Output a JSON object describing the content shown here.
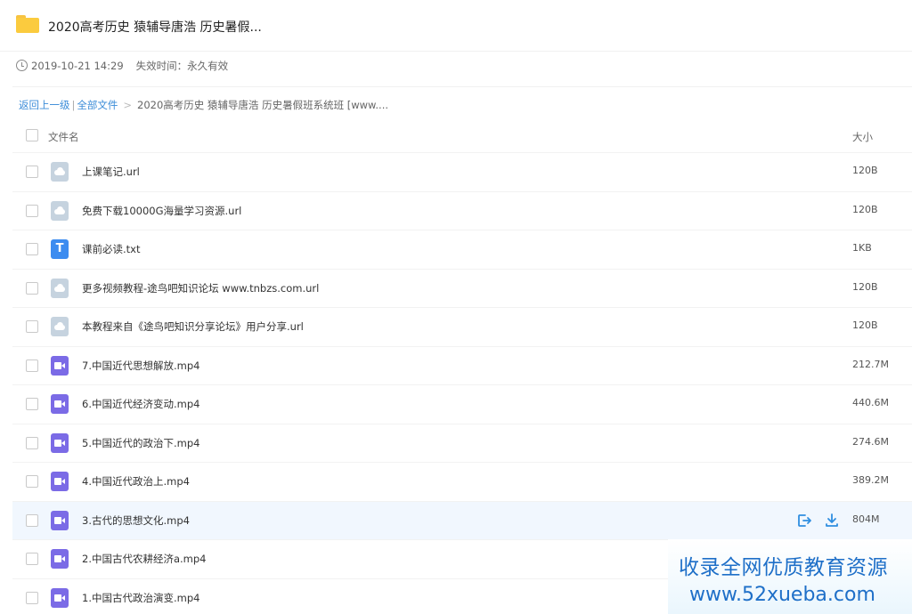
{
  "share": {
    "title": "2020高考历史 猿辅导唐浩 历史暑假...",
    "created_at": "2019-10-21 14:29",
    "expiry_label": "失效时间：",
    "expiry_value": "永久有效"
  },
  "breadcrumb": {
    "back": "返回上一级",
    "separator": "|",
    "all_files": "全部文件",
    "arrow": ">",
    "current": "2020高考历史 猿辅导唐浩 历史暑假班系统班 [www...."
  },
  "columns": {
    "name": "文件名",
    "size": "大小"
  },
  "files": [
    {
      "name": "上课笔记.url",
      "size": "120B",
      "type": "url"
    },
    {
      "name": "免费下载10000G海量学习资源.url",
      "size": "120B",
      "type": "url"
    },
    {
      "name": "课前必读.txt",
      "size": "1KB",
      "type": "txt",
      "icon_letter": "T"
    },
    {
      "name": "更多视频教程-途鸟吧知识论坛 www.tnbzs.com.url",
      "size": "120B",
      "type": "url"
    },
    {
      "name": "本教程来自《途鸟吧知识分享论坛》用户分享.url",
      "size": "120B",
      "type": "url"
    },
    {
      "name": "7.中国近代思想解放.mp4",
      "size": "212.7M",
      "type": "mp4"
    },
    {
      "name": "6.中国近代经济变动.mp4",
      "size": "440.6M",
      "type": "mp4"
    },
    {
      "name": "5.中国近代的政治下.mp4",
      "size": "274.6M",
      "type": "mp4"
    },
    {
      "name": "4.中国近代政治上.mp4",
      "size": "389.2M",
      "type": "mp4"
    },
    {
      "name": "3.古代的思想文化.mp4",
      "size": "804M",
      "type": "mp4"
    },
    {
      "name": "2.中国古代农耕经济a.mp4",
      "size": "",
      "type": "mp4"
    },
    {
      "name": "1.中国古代政治演变.mp4",
      "size": "",
      "type": "mp4"
    }
  ],
  "watermark": {
    "line1": "收录全网优质教育资源",
    "line2": "www.52xueba.com"
  },
  "colors": {
    "link": "#3b8cd8",
    "folder": "#fbcb3e",
    "video_icon": "#7b6be6",
    "txt_icon": "#3c8cf0",
    "url_icon": "#c6d3df",
    "hover_row": "#f1f7fe",
    "action_icon": "#2f8ee0"
  }
}
